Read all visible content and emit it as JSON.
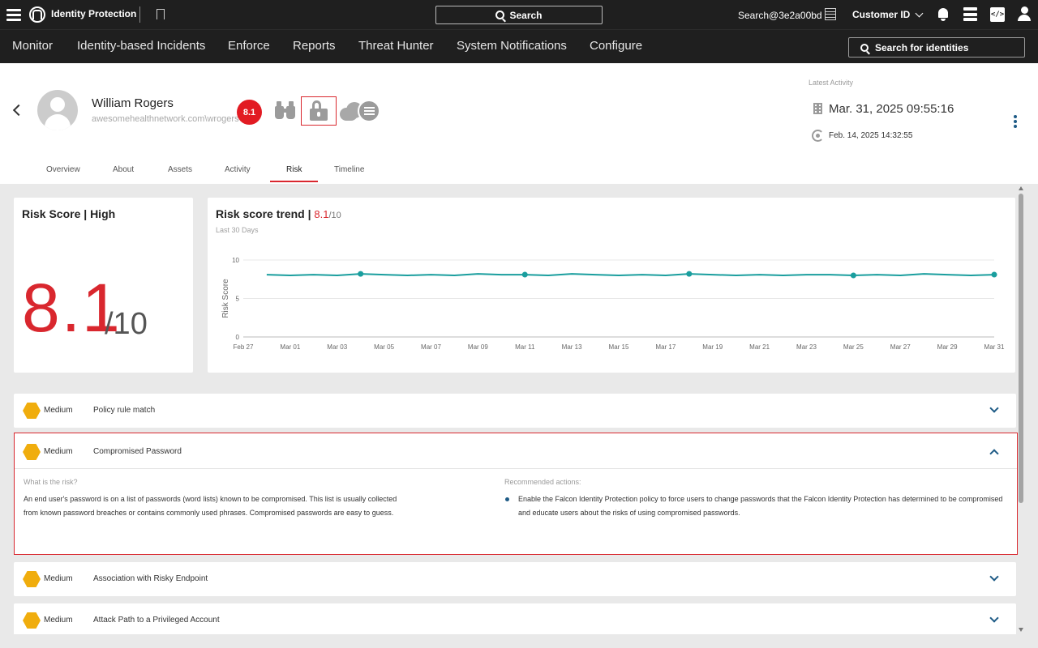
{
  "topbar": {
    "app_title": "Identity Protection",
    "search_label": "Search",
    "user_cid": "Search@3e2a00bd",
    "customer_id_label": "Customer ID",
    "code_icon_text": "</>"
  },
  "nav": {
    "items": [
      "Monitor",
      "Identity-based Incidents",
      "Enforce",
      "Reports",
      "Threat Hunter",
      "System Notifications",
      "Configure"
    ],
    "identity_search_placeholder": "Search for identities"
  },
  "profile": {
    "name": "William Rogers",
    "account": "awesomehealthnetwork.com\\wrogers",
    "risk_badge": "8.1",
    "latest_activity_label": "Latest Activity",
    "latest_activity_date": "Mar. 31, 2025 09:55:16",
    "sync_date": "Feb. 14, 2025 14:32:55",
    "tabs": [
      "Overview",
      "About",
      "Assets",
      "Activity",
      "Risk",
      "Timeline"
    ],
    "active_tab": "Risk"
  },
  "risk_score": {
    "title": "Risk Score | High",
    "value": "8.1",
    "max": "/10"
  },
  "trend": {
    "title_prefix": "Risk score trend | ",
    "score": "8.1",
    "max": "/10",
    "subtitle": "Last 30 Days"
  },
  "chart_data": {
    "type": "line",
    "ylabel": "Risk Score",
    "xlabel": "",
    "ylim": [
      0,
      10
    ],
    "yticks": [
      0,
      5,
      10
    ],
    "x_tick_labels": [
      "Feb 27",
      "Mar 01",
      "Mar 03",
      "Mar 05",
      "Mar 07",
      "Mar 09",
      "Mar 11",
      "Mar 13",
      "Mar 15",
      "Mar 17",
      "Mar 19",
      "Mar 21",
      "Mar 23",
      "Mar 25",
      "Mar 27",
      "Mar 29",
      "Mar 31"
    ],
    "color": "#1a9e9e",
    "series": [
      {
        "x": [
          "Feb 28",
          "Mar 01",
          "Mar 02",
          "Mar 03",
          "Mar 04",
          "Mar 05",
          "Mar 06",
          "Mar 07",
          "Mar 08",
          "Mar 09",
          "Mar 10",
          "Mar 11",
          "Mar 12",
          "Mar 13",
          "Mar 14",
          "Mar 15",
          "Mar 16",
          "Mar 17",
          "Mar 18",
          "Mar 19",
          "Mar 20",
          "Mar 21",
          "Mar 22",
          "Mar 23",
          "Mar 24",
          "Mar 25",
          "Mar 26",
          "Mar 27",
          "Mar 28",
          "Mar 29",
          "Mar 30",
          "Mar 31"
        ],
        "values": [
          8.1,
          8.0,
          8.1,
          8.0,
          8.2,
          8.1,
          8.0,
          8.1,
          8.0,
          8.2,
          8.1,
          8.1,
          8.0,
          8.2,
          8.1,
          8.0,
          8.1,
          8.0,
          8.2,
          8.1,
          8.0,
          8.1,
          8.0,
          8.1,
          8.1,
          8.0,
          8.1,
          8.0,
          8.2,
          8.1,
          8.0,
          8.1
        ],
        "markers": [
          "Mar 04",
          "Mar 11",
          "Mar 18",
          "Mar 25",
          "Mar 31"
        ]
      }
    ]
  },
  "risks": [
    {
      "severity": "Medium",
      "title": "Policy rule match"
    },
    {
      "severity": "Medium",
      "title": "Compromised Password",
      "what_label": "What is the risk?",
      "what_text": "An end user's password is on a list of passwords (word lists) known to be compromised. This list is usually collected from known password breaches or contains commonly used phrases. Compromised passwords are easy to guess.",
      "actions_label": "Recommended actions:",
      "action_text": "Enable the Falcon Identity Protection policy to force users to change passwords that the Falcon Identity Protection has determined to be compromised and educate users about the risks of using compromised passwords."
    },
    {
      "severity": "Medium",
      "title": "Association with Risky Endpoint"
    },
    {
      "severity": "Medium",
      "title": "Attack Path to a Privileged Account"
    }
  ]
}
